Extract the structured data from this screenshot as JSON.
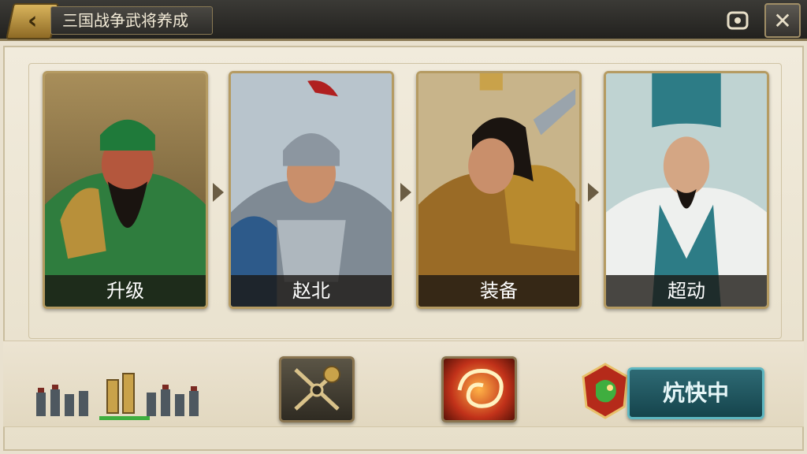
{
  "header": {
    "back_icon": "chevron-left-icon",
    "title": "三国战争武将养成",
    "settings_icon": "settings-icon",
    "close_icon": "close-icon",
    "close_label": "✕"
  },
  "cards": [
    {
      "label": "升级",
      "portrait": "guan-yu-portrait",
      "color": "#2f7d3e"
    },
    {
      "label": "赵北",
      "portrait": "armored-general-portrait",
      "color": "#2d5a8a"
    },
    {
      "label": "装备",
      "portrait": "gold-armor-warrior-portrait",
      "color": "#9a6b26"
    },
    {
      "label": "超动",
      "portrait": "strategist-portrait",
      "color": "#2d7c86"
    }
  ],
  "bottom": {
    "army_icon": "army-formation-icon",
    "skill_buttons": [
      {
        "icon": "crossed-weapons-icon"
      },
      {
        "icon": "fire-vortex-icon"
      }
    ],
    "emblem_icon": "dragon-emblem-icon",
    "status_label": "炕快中"
  },
  "colors": {
    "accent_gold": "#b59b62",
    "status_teal": "#2e6a74",
    "progress_green": "#3fae3f"
  }
}
